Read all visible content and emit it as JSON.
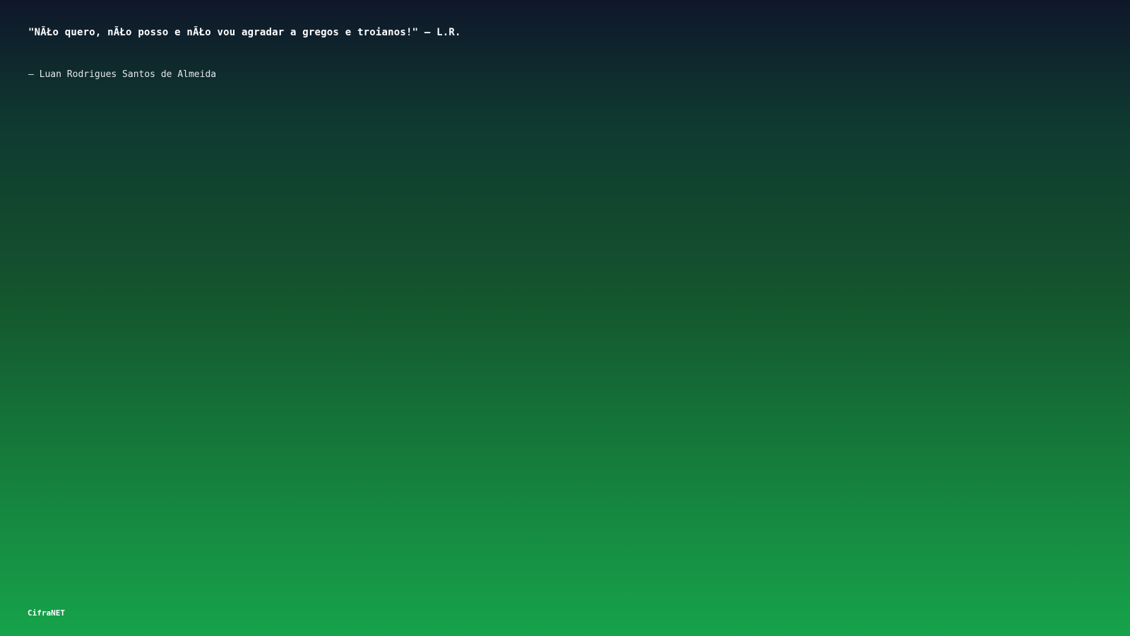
{
  "quote": {
    "text": "\"NÃŁo quero, nÃŁo posso e nÃŁo vou agradar a gregos e troianos!\" — L.R."
  },
  "author": {
    "text": "— Luan Rodrigues Santos de Almeida"
  },
  "brand": {
    "name": "CifraNET"
  },
  "colors": {
    "gradient_top": "#0f172a",
    "gradient_bottom": "#16a34a",
    "text": "#ffffff"
  }
}
